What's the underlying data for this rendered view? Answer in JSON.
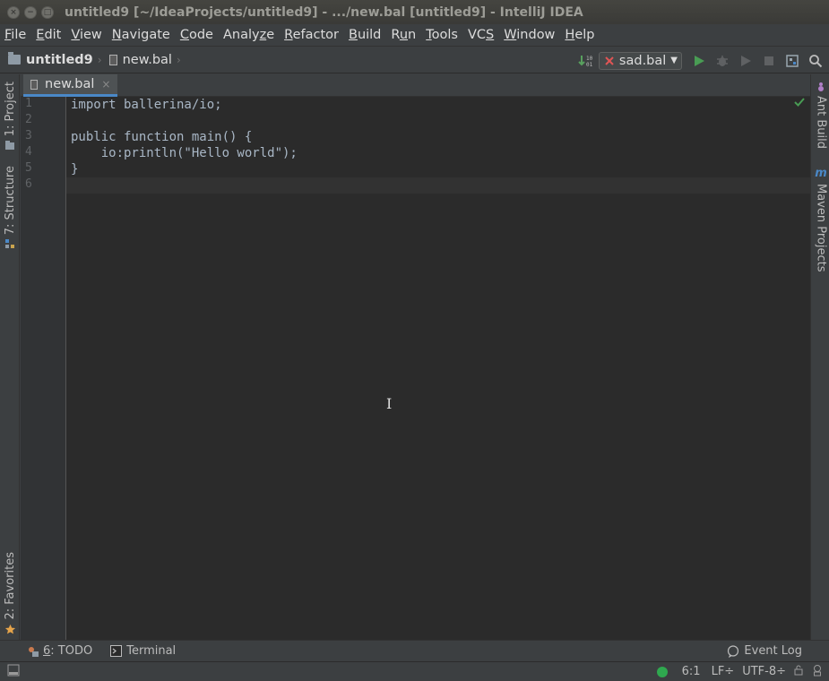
{
  "window": {
    "title": "untitled9 [~/IdeaProjects/untitled9] - .../new.bal [untitled9] - IntelliJ IDEA",
    "buttons": [
      "×",
      "−",
      "□"
    ]
  },
  "menu": [
    {
      "underline": "F",
      "rest": "ile"
    },
    {
      "underline": "E",
      "rest": "dit"
    },
    {
      "underline": "V",
      "rest": "iew"
    },
    {
      "underline": "N",
      "rest": "avigate"
    },
    {
      "underline": "C",
      "rest": "ode"
    },
    {
      "pre": "Analy",
      "underline": "z",
      "rest": "e"
    },
    {
      "underline": "R",
      "rest": "efactor"
    },
    {
      "underline": "B",
      "rest": "uild"
    },
    {
      "pre": "R",
      "underline": "u",
      "rest": "n"
    },
    {
      "underline": "T",
      "rest": "ools"
    },
    {
      "pre": "VC",
      "underline": "S",
      "rest": ""
    },
    {
      "underline": "W",
      "rest": "indow"
    },
    {
      "underline": "H",
      "rest": "elp"
    }
  ],
  "breadcrumb": {
    "project": "untitled9",
    "file": "new.bal"
  },
  "run_config": {
    "name": "sad.bal"
  },
  "left_tools": {
    "project": "1: Project",
    "structure": "7: Structure",
    "favorites": "2: Favorites"
  },
  "right_tools": {
    "ant": "Ant Build",
    "maven": "Maven Projects"
  },
  "tab": {
    "label": "new.bal",
    "close": "×"
  },
  "editor": {
    "line_numbers": [
      "1",
      "2",
      "3",
      "4",
      "5",
      "6"
    ],
    "lines": [
      "import ballerina/io;",
      "",
      "public function main() {",
      "    io:println(\"Hello world\");",
      "}",
      ""
    ],
    "cursor_glyph": "I"
  },
  "bottom_tools": {
    "todo_num": "6",
    "todo_rest": ": TODO",
    "terminal": "Terminal",
    "event_log": "Event Log"
  },
  "status": {
    "position": "6:1",
    "line_sep": "LF÷",
    "encoding": "UTF-8÷"
  },
  "colors": {
    "accent": "#4a88c7",
    "run_green": "#499c54",
    "status_ok": "#2fa84f"
  }
}
